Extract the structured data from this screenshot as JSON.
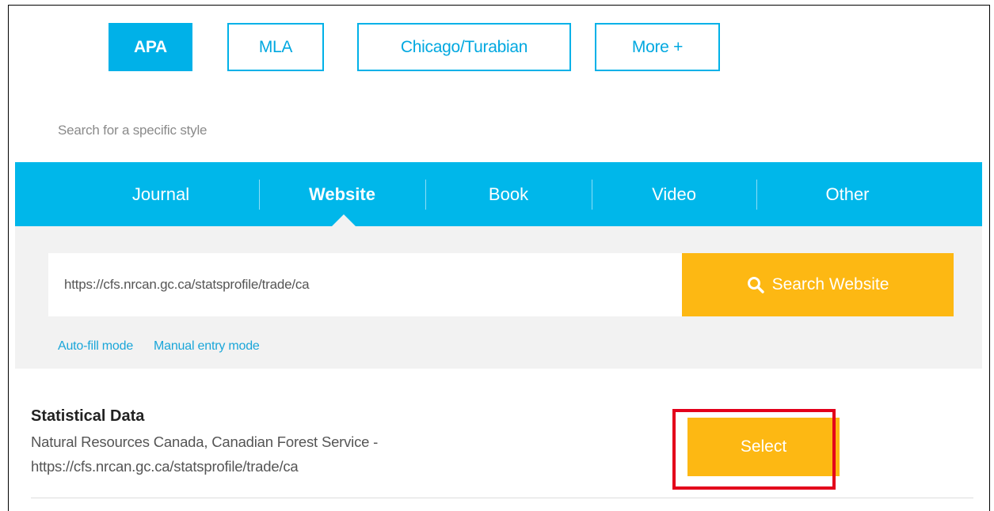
{
  "style_buttons": [
    {
      "label": "APA",
      "active": true
    },
    {
      "label": "MLA",
      "active": false
    },
    {
      "label": "Chicago/Turabian",
      "active": false
    },
    {
      "label": "More +",
      "active": false
    }
  ],
  "style_search": {
    "placeholder": "Search for a specific style"
  },
  "source_tabs": [
    {
      "label": "Journal",
      "active": false
    },
    {
      "label": "Website",
      "active": true
    },
    {
      "label": "Book",
      "active": false
    },
    {
      "label": "Video",
      "active": false
    },
    {
      "label": "Other",
      "active": false
    }
  ],
  "website_search": {
    "value": "https://cfs.nrcan.gc.ca/statsprofile/trade/ca",
    "button_label": "Search Website",
    "icon": "search-icon"
  },
  "modes": {
    "auto_fill": "Auto-fill mode",
    "manual": "Manual entry mode"
  },
  "result": {
    "title": "Statistical Data",
    "publisher": "Natural Resources Canada, Canadian Forest Service -",
    "url": "https://cfs.nrcan.gc.ca/statsprofile/trade/ca",
    "select_label": "Select"
  },
  "colors": {
    "accent_blue": "#00b7ea",
    "accent_orange": "#fdb813",
    "highlight_red": "#e3001b",
    "panel_gray": "#f2f2f2"
  }
}
